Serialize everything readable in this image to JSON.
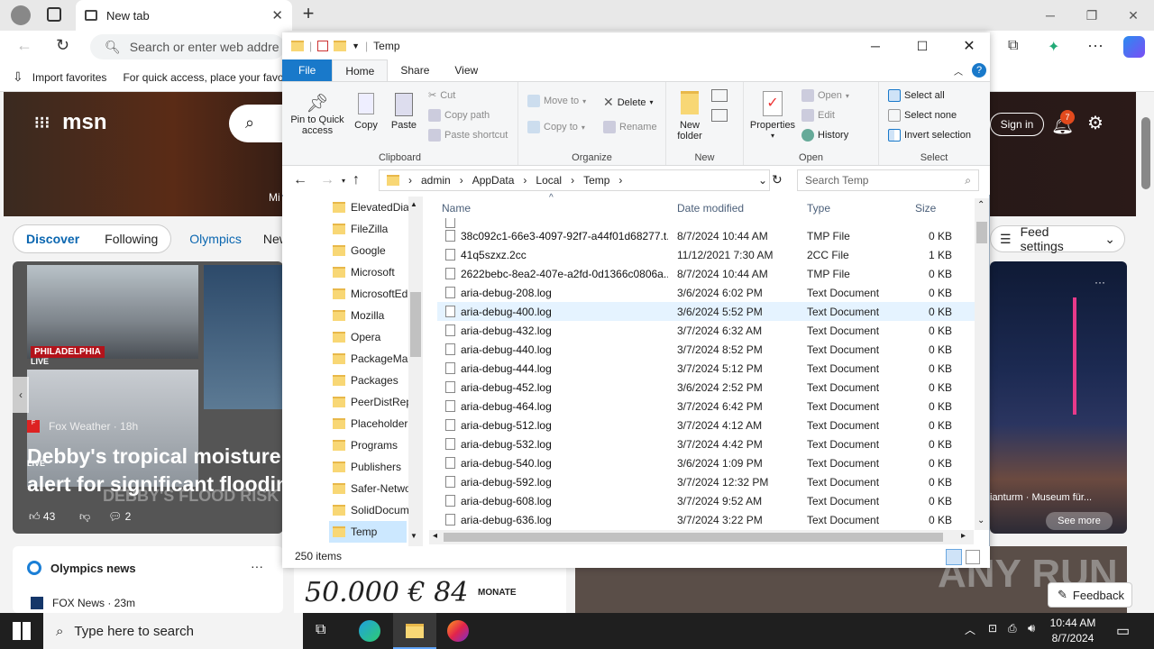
{
  "browser": {
    "tab_title": "New tab",
    "address_placeholder": "Search or enter web addre",
    "favorites": {
      "import": "Import favorites",
      "hint": "For quick access, place your favo"
    }
  },
  "msn": {
    "logo": "msn",
    "signin": "Sign in",
    "notif_count": "7",
    "partial_left_text": "Mi",
    "tabs": [
      "Discover",
      "Following",
      "Olympics",
      "News"
    ],
    "feed_settings": "Feed settings",
    "card1": {
      "location": "PHILADELPHIA",
      "live": "LIVE",
      "live2": "LIVE",
      "source": "Fox Weather · 18h",
      "headline_l1": "Debby's tropical moisture",
      "headline_l2": "alert for significant floodin",
      "likes": "43",
      "comments": "2",
      "overlay": "DEBBY'S FLOOD RISK"
    },
    "card2": {
      "caption": "ianturm · Museum für...",
      "see_more": "See more"
    },
    "olympics": {
      "title": "Olympics news",
      "source": "FOX News · 23m"
    },
    "ad": {
      "text": "50.000 € 84",
      "unit": "MONATE"
    },
    "feedback": "Feedback",
    "watermark": "ANY RUN"
  },
  "explorer": {
    "title": "Temp",
    "ribbon_tabs": [
      "File",
      "Home",
      "Share",
      "View"
    ],
    "clipboard": {
      "label": "Clipboard",
      "pin": "Pin to Quick access",
      "copy": "Copy",
      "paste": "Paste",
      "cut": "Cut",
      "copy_path": "Copy path",
      "paste_shortcut": "Paste shortcut"
    },
    "organize": {
      "label": "Organize",
      "move_to": "Move to",
      "copy_to": "Copy to",
      "delete": "Delete",
      "rename": "Rename"
    },
    "new": {
      "label": "New",
      "new_folder": "New folder"
    },
    "open": {
      "label": "Open",
      "properties": "Properties",
      "open": "Open",
      "edit": "Edit",
      "history": "History"
    },
    "select": {
      "label": "Select",
      "all": "Select all",
      "none": "Select none",
      "invert": "Invert selection"
    },
    "path": [
      "admin",
      "AppData",
      "Local",
      "Temp"
    ],
    "search_placeholder": "Search Temp",
    "tree": [
      "ElevatedDia",
      "FileZilla",
      "Google",
      "Microsoft",
      "MicrosoftEd",
      "Mozilla",
      "Opera",
      "PackageMa",
      "Packages",
      "PeerDistRep",
      "Placeholder",
      "Programs",
      "Publishers",
      "Safer-Netwo",
      "SolidDocum",
      "Temp"
    ],
    "columns": {
      "name": "Name",
      "date": "Date modified",
      "type": "Type",
      "size": "Size"
    },
    "files": [
      {
        "name": "38c092c1-66e3-4097-92f7-a44f01d68277.t...",
        "date": "8/7/2024 10:44 AM",
        "type": "TMP File",
        "size": "0 KB"
      },
      {
        "name": "41q5szxz.2cc",
        "date": "11/12/2021 7:30 AM",
        "type": "2CC File",
        "size": "1 KB"
      },
      {
        "name": "2622bebc-8ea2-407e-a2fd-0d1366c0806a....",
        "date": "8/7/2024 10:44 AM",
        "type": "TMP File",
        "size": "0 KB"
      },
      {
        "name": "aria-debug-208.log",
        "date": "3/6/2024 6:02 PM",
        "type": "Text Document",
        "size": "0 KB"
      },
      {
        "name": "aria-debug-400.log",
        "date": "3/6/2024 5:52 PM",
        "type": "Text Document",
        "size": "0 KB"
      },
      {
        "name": "aria-debug-432.log",
        "date": "3/7/2024 6:32 AM",
        "type": "Text Document",
        "size": "0 KB"
      },
      {
        "name": "aria-debug-440.log",
        "date": "3/7/2024 8:52 PM",
        "type": "Text Document",
        "size": "0 KB"
      },
      {
        "name": "aria-debug-444.log",
        "date": "3/7/2024 5:12 PM",
        "type": "Text Document",
        "size": "0 KB"
      },
      {
        "name": "aria-debug-452.log",
        "date": "3/6/2024 2:52 PM",
        "type": "Text Document",
        "size": "0 KB"
      },
      {
        "name": "aria-debug-464.log",
        "date": "3/7/2024 6:42 PM",
        "type": "Text Document",
        "size": "0 KB"
      },
      {
        "name": "aria-debug-512.log",
        "date": "3/7/2024 4:12 AM",
        "type": "Text Document",
        "size": "0 KB"
      },
      {
        "name": "aria-debug-532.log",
        "date": "3/7/2024 4:42 PM",
        "type": "Text Document",
        "size": "0 KB"
      },
      {
        "name": "aria-debug-540.log",
        "date": "3/6/2024 1:09 PM",
        "type": "Text Document",
        "size": "0 KB"
      },
      {
        "name": "aria-debug-592.log",
        "date": "3/7/2024 12:32 PM",
        "type": "Text Document",
        "size": "0 KB"
      },
      {
        "name": "aria-debug-608.log",
        "date": "3/7/2024 9:52 AM",
        "type": "Text Document",
        "size": "0 KB"
      },
      {
        "name": "aria-debug-636.log",
        "date": "3/7/2024 3:22 PM",
        "type": "Text Document",
        "size": "0 KB"
      }
    ],
    "status": "250 items"
  },
  "taskbar": {
    "search": "Type here to search",
    "time": "10:44 AM",
    "date": "8/7/2024"
  }
}
